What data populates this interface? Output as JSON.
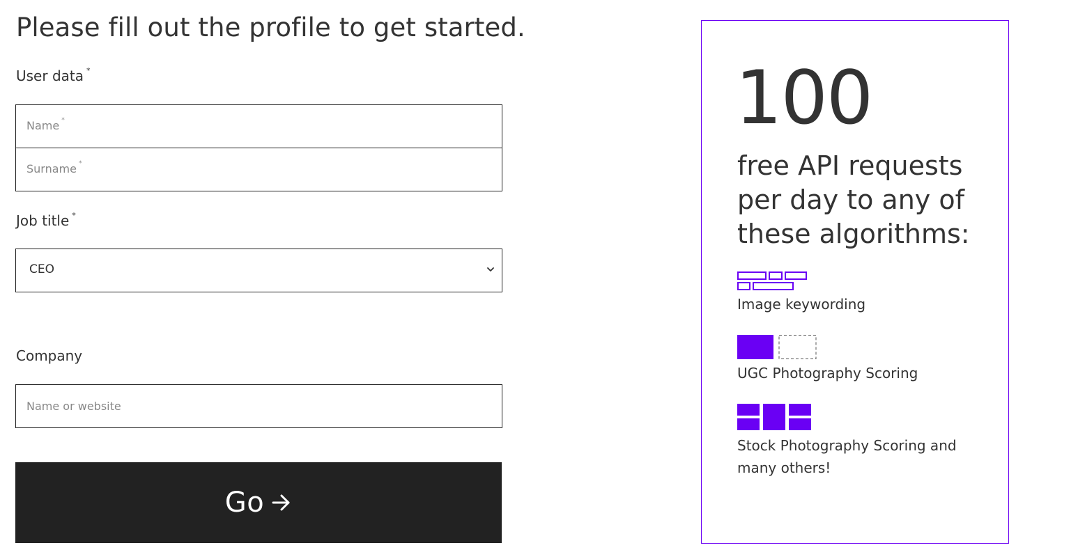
{
  "form": {
    "headline": "Please fill out the profile to get started.",
    "user_data_label": "User data",
    "required_mark": "*",
    "name_placeholder": "Name",
    "surname_placeholder": "Surname",
    "job_title_label": "Job title",
    "job_title_value": "CEO",
    "company_label": "Company",
    "company_placeholder": "Name or website",
    "go_label": "Go"
  },
  "promo": {
    "count": "100",
    "text": "free API requests per day to any of these algorithms:",
    "algorithms": [
      {
        "label": "Image keywording",
        "icon": "keywording-icon"
      },
      {
        "label": "UGC Photography Scoring",
        "icon": "ugc-scoring-icon"
      },
      {
        "label": "Stock Photography Scoring and many others!",
        "icon": "stock-scoring-icon"
      }
    ],
    "accent_color": "#6a00f4"
  },
  "colors": {
    "text": "#333333",
    "button_bg": "#222222",
    "button_text": "#ffffff",
    "placeholder": "#888888"
  }
}
